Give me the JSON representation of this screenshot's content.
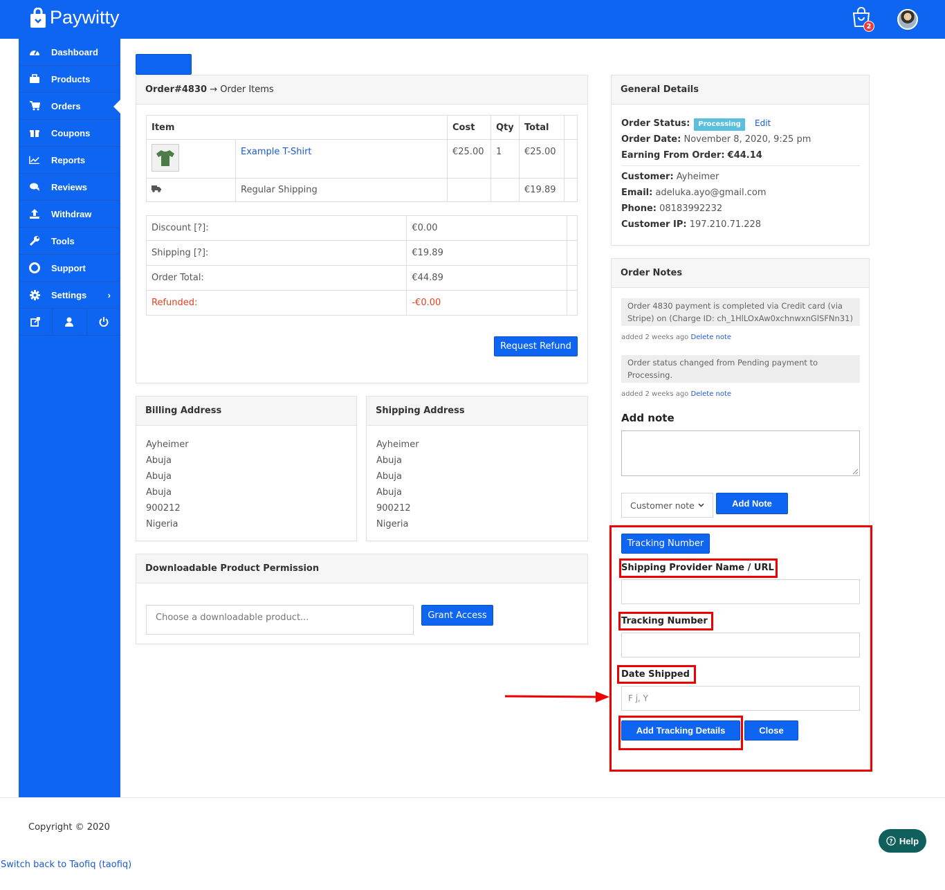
{
  "header": {
    "brand": "Paywitty",
    "cart_count": "2"
  },
  "sidebar": {
    "items": [
      {
        "label": "Dashboard",
        "icon": "dashboard-icon"
      },
      {
        "label": "Products",
        "icon": "briefcase-icon"
      },
      {
        "label": "Orders",
        "icon": "cart-icon"
      },
      {
        "label": "Coupons",
        "icon": "gift-icon"
      },
      {
        "label": "Reports",
        "icon": "chart-icon"
      },
      {
        "label": "Reviews",
        "icon": "comments-icon"
      },
      {
        "label": "Withdraw",
        "icon": "upload-icon"
      },
      {
        "label": "Tools",
        "icon": "wrench-icon"
      },
      {
        "label": "Support",
        "icon": "lifebuoy-icon"
      },
      {
        "label": "Settings",
        "icon": "gear-icon"
      }
    ],
    "active": "Orders"
  },
  "order": {
    "head_id": "Order#4830",
    "head_arrow": " → ",
    "head_label": "Order Items",
    "table_headers": [
      "Item",
      "Cost",
      "Qty",
      "Total"
    ],
    "item": {
      "name": "Example T-Shirt",
      "cost": "€25.00",
      "qty": "1",
      "total": "€25.00"
    },
    "shipping_row": {
      "name": "Regular Shipping",
      "total": "€19.89"
    },
    "totals": [
      {
        "label": "Discount [?]:",
        "value": "€0.00"
      },
      {
        "label": "Shipping [?]:",
        "value": "€19.89"
      },
      {
        "label": "Order Total:",
        "value": "€44.89"
      },
      {
        "label": "Refunded:",
        "value": "-€0.00"
      }
    ],
    "refund_button": "Request Refund"
  },
  "billing": {
    "title": "Billing Address",
    "lines": [
      "Ayheimer",
      "Abuja",
      "Abuja",
      "Abuja",
      "900212",
      "Nigeria"
    ]
  },
  "shipping": {
    "title": "Shipping Address",
    "lines": [
      "Ayheimer",
      "Abuja",
      "Abuja",
      "Abuja",
      "900212",
      "Nigeria"
    ]
  },
  "downloads": {
    "title": "Downloadable Product Permission",
    "placeholder": "Choose a downloadable product...",
    "grant_button": "Grant Access"
  },
  "general": {
    "title": "General Details",
    "status_label": "Order Status:",
    "status_value": "Processing",
    "edit_link": "Edit",
    "date_label": "Order Date:",
    "date_value": "November 8, 2020, 9:25 pm",
    "earning_label": "Earning From Order:",
    "earning_value": "€44.14",
    "customer_label": "Customer:",
    "customer_value": "Ayheimer",
    "email_label": "Email:",
    "email_value": "adeluka.ayo@gmail.com",
    "phone_label": "Phone:",
    "phone_value": "08183992232",
    "ip_label": "Customer IP:",
    "ip_value": "197.210.71.228"
  },
  "notes": {
    "title": "Order Notes",
    "list": [
      {
        "text": "Order 4830 payment is completed via Credit card (via Stripe) on (Charge ID: ch_1HlLOxAw0xchnwxnGlSFNn31)",
        "meta": "added 2 weeks ago",
        "delete": "Delete note"
      },
      {
        "text": "Order status changed from Pending payment to Processing.",
        "meta": "added 2 weeks ago",
        "delete": "Delete note"
      }
    ],
    "add_title": "Add note",
    "type_value": "Customer note",
    "add_button": "Add Note"
  },
  "tracking": {
    "toggle_button": "Tracking Number",
    "provider_label": "Shipping Provider Name / URL",
    "number_label": "Tracking Number",
    "date_label": "Date Shipped",
    "date_placeholder": "F j, Y",
    "add_button": "Add Tracking Details",
    "close_button": "Close"
  },
  "footer": {
    "copyright": "Copyright © 2020",
    "switch_link": "Switch back to Taofiq (taofiq)",
    "help": "Help"
  },
  "colors": {
    "primary": "#0d65f2",
    "annotation": "#ee0000",
    "status_badge": "#5bc0de",
    "help": "#0f5f5c"
  }
}
